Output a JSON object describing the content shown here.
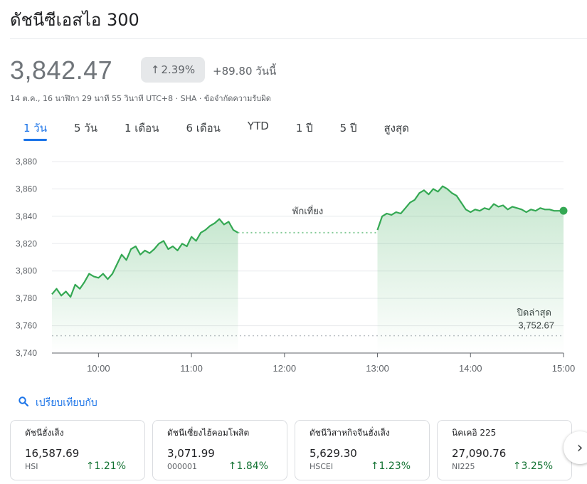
{
  "header": {
    "title": "ดัชนีซีเอสไอ 300",
    "price": "3,842.47",
    "pct_change": "2.39%",
    "abs_change": "+89.80 วันนี้",
    "subinfo": "14 ต.ค., 16 นาฬิกา 29 นาที 55 วินาที UTC+8 · SHA · ข้อจำกัดความรับผิด"
  },
  "tabs": [
    {
      "label": "1 วัน",
      "active": true
    },
    {
      "label": "5 วัน",
      "active": false
    },
    {
      "label": "1 เดือน",
      "active": false
    },
    {
      "label": "6 เดือน",
      "active": false
    },
    {
      "label": "YTD",
      "active": false
    },
    {
      "label": "1 ปี",
      "active": false
    },
    {
      "label": "5 ปี",
      "active": false
    },
    {
      "label": "สูงสุด",
      "active": false
    }
  ],
  "colors": {
    "line": "#34a853",
    "area_top": "#34a853",
    "positive": "#137333",
    "accent": "#1a73e8"
  },
  "chart_data": {
    "type": "area",
    "xlim": [
      "09:30",
      "15:00"
    ],
    "ylim": [
      3740,
      3880
    ],
    "yticks": [
      "3,880",
      "3,860",
      "3,840",
      "3,820",
      "3,800",
      "3,780",
      "3,760",
      "3,740"
    ],
    "yticks_values": [
      3880,
      3860,
      3840,
      3820,
      3800,
      3780,
      3760,
      3740
    ],
    "xticks": [
      "10:00",
      "11:00",
      "12:00",
      "13:00",
      "14:00",
      "15:00"
    ],
    "grid": true,
    "lunch_break_label": "พักเที่ยง",
    "lunch_break": [
      "11:30",
      "13:00"
    ],
    "lunch_level": 3828,
    "prev_close_label": "ปิดล่าสุด",
    "prev_close_value_label": "3,752.67",
    "prev_close": 3752.67,
    "last_value": 3844,
    "morning": [
      [
        "09:30",
        3783
      ],
      [
        "09:33",
        3787
      ],
      [
        "09:36",
        3782
      ],
      [
        "09:39",
        3785
      ],
      [
        "09:42",
        3781
      ],
      [
        "09:45",
        3790
      ],
      [
        "09:48",
        3787
      ],
      [
        "09:51",
        3792
      ],
      [
        "09:54",
        3798
      ],
      [
        "09:57",
        3796
      ],
      [
        "10:00",
        3795
      ],
      [
        "10:03",
        3798
      ],
      [
        "10:06",
        3794
      ],
      [
        "10:09",
        3798
      ],
      [
        "10:12",
        3805
      ],
      [
        "10:15",
        3812
      ],
      [
        "10:18",
        3808
      ],
      [
        "10:21",
        3816
      ],
      [
        "10:24",
        3818
      ],
      [
        "10:27",
        3812
      ],
      [
        "10:30",
        3815
      ],
      [
        "10:33",
        3813
      ],
      [
        "10:36",
        3816
      ],
      [
        "10:39",
        3820
      ],
      [
        "10:42",
        3822
      ],
      [
        "10:45",
        3816
      ],
      [
        "10:48",
        3818
      ],
      [
        "10:51",
        3815
      ],
      [
        "10:54",
        3820
      ],
      [
        "10:57",
        3818
      ],
      [
        "11:00",
        3825
      ],
      [
        "11:03",
        3822
      ],
      [
        "11:06",
        3828
      ],
      [
        "11:09",
        3830
      ],
      [
        "11:12",
        3833
      ],
      [
        "11:15",
        3835
      ],
      [
        "11:18",
        3838
      ],
      [
        "11:21",
        3834
      ],
      [
        "11:24",
        3836
      ],
      [
        "11:27",
        3830
      ],
      [
        "11:30",
        3828
      ]
    ],
    "afternoon": [
      [
        "13:00",
        3830
      ],
      [
        "13:03",
        3840
      ],
      [
        "13:06",
        3842
      ],
      [
        "13:09",
        3841
      ],
      [
        "13:12",
        3843
      ],
      [
        "13:15",
        3842
      ],
      [
        "13:18",
        3846
      ],
      [
        "13:21",
        3850
      ],
      [
        "13:24",
        3852
      ],
      [
        "13:27",
        3857
      ],
      [
        "13:30",
        3859
      ],
      [
        "13:33",
        3856
      ],
      [
        "13:36",
        3860
      ],
      [
        "13:39",
        3858
      ],
      [
        "13:42",
        3862
      ],
      [
        "13:45",
        3860
      ],
      [
        "13:48",
        3857
      ],
      [
        "13:51",
        3855
      ],
      [
        "13:54",
        3850
      ],
      [
        "13:57",
        3845
      ],
      [
        "14:00",
        3843
      ],
      [
        "14:03",
        3845
      ],
      [
        "14:06",
        3844
      ],
      [
        "14:09",
        3846
      ],
      [
        "14:12",
        3845
      ],
      [
        "14:15",
        3849
      ],
      [
        "14:18",
        3847
      ],
      [
        "14:21",
        3848
      ],
      [
        "14:24",
        3845
      ],
      [
        "14:27",
        3847
      ],
      [
        "14:30",
        3846
      ],
      [
        "14:33",
        3845
      ],
      [
        "14:36",
        3843
      ],
      [
        "14:39",
        3845
      ],
      [
        "14:42",
        3844
      ],
      [
        "14:45",
        3846
      ],
      [
        "14:48",
        3845
      ],
      [
        "14:51",
        3845
      ],
      [
        "14:54",
        3844
      ],
      [
        "14:57",
        3844
      ],
      [
        "15:00",
        3844
      ]
    ]
  },
  "compare": {
    "label": "เปรียบเทียบกับ"
  },
  "cards": [
    {
      "name": "ดัชนีฮั่งเส็ง",
      "value": "16,587.69",
      "symbol": "HSI",
      "pct": "1.21%"
    },
    {
      "name": "ดัชนีเซี่ยงไฮ้คอมโพสิต",
      "value": "3,071.99",
      "symbol": "000001",
      "pct": "1.84%"
    },
    {
      "name": "ดัชนีวิสาหกิจจีนฮั่งเส็ง",
      "value": "5,629.30",
      "symbol": "HSCEI",
      "pct": "1.23%"
    },
    {
      "name": "นิคเคอิ 225",
      "value": "27,090.76",
      "symbol": "NI225",
      "pct": "3.25%"
    }
  ]
}
